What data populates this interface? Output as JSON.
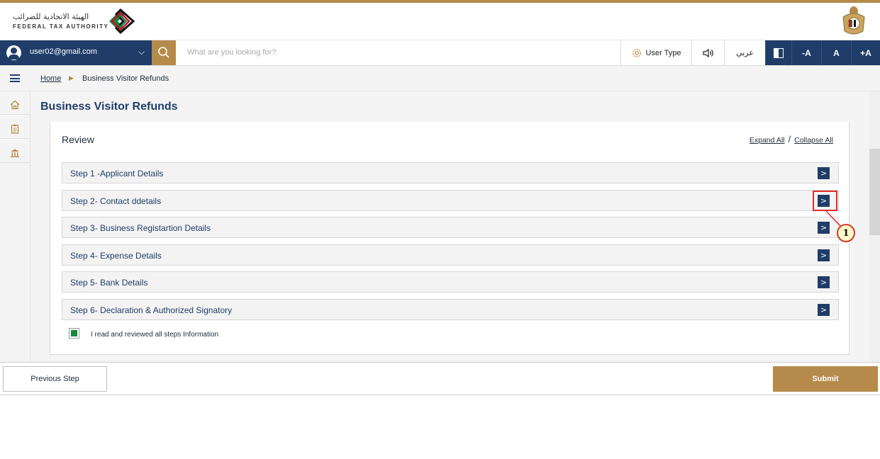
{
  "header": {
    "org_name_ar": "الهيئة الاتحادية للضرائب",
    "org_name_en": "FEDERAL TAX AUTHORITY"
  },
  "nav": {
    "user_email": "user02@gmail.com",
    "search_placeholder": "What are you looking for?",
    "user_type_label": "User Type",
    "language_label": "عربي",
    "font_decrease": "-A",
    "font_normal": "A",
    "font_increase": "+A"
  },
  "breadcrumb": {
    "home": "Home",
    "current": "Business Visitor Refunds"
  },
  "page": {
    "title": "Business Visitor Refunds"
  },
  "review": {
    "title": "Review",
    "expand_all": "Expand All",
    "separator": "/",
    "collapse_all": "Collapse All",
    "steps": [
      {
        "label": "Step 1 -Applicant Details"
      },
      {
        "label": "Step 2- Contact ddetails"
      },
      {
        "label": "Step 3- Business Registartion Details"
      },
      {
        "label": "Step 4- Expense Details"
      },
      {
        "label": "Step 5- Bank Details"
      },
      {
        "label": "Step 6- Declaration & Authorized Signatory"
      }
    ],
    "expand_glyph": ">",
    "confirm_checked": true,
    "confirm_label": "I read and reviewed all steps Information"
  },
  "annotation": {
    "callout_number": "1"
  },
  "footer": {
    "previous_label": "Previous Step",
    "submit_label": "Submit"
  },
  "colors": {
    "navy": "#1f3d68",
    "gold": "#b68a4a",
    "check_green": "#16893f",
    "highlight_red": "#e0302b"
  }
}
